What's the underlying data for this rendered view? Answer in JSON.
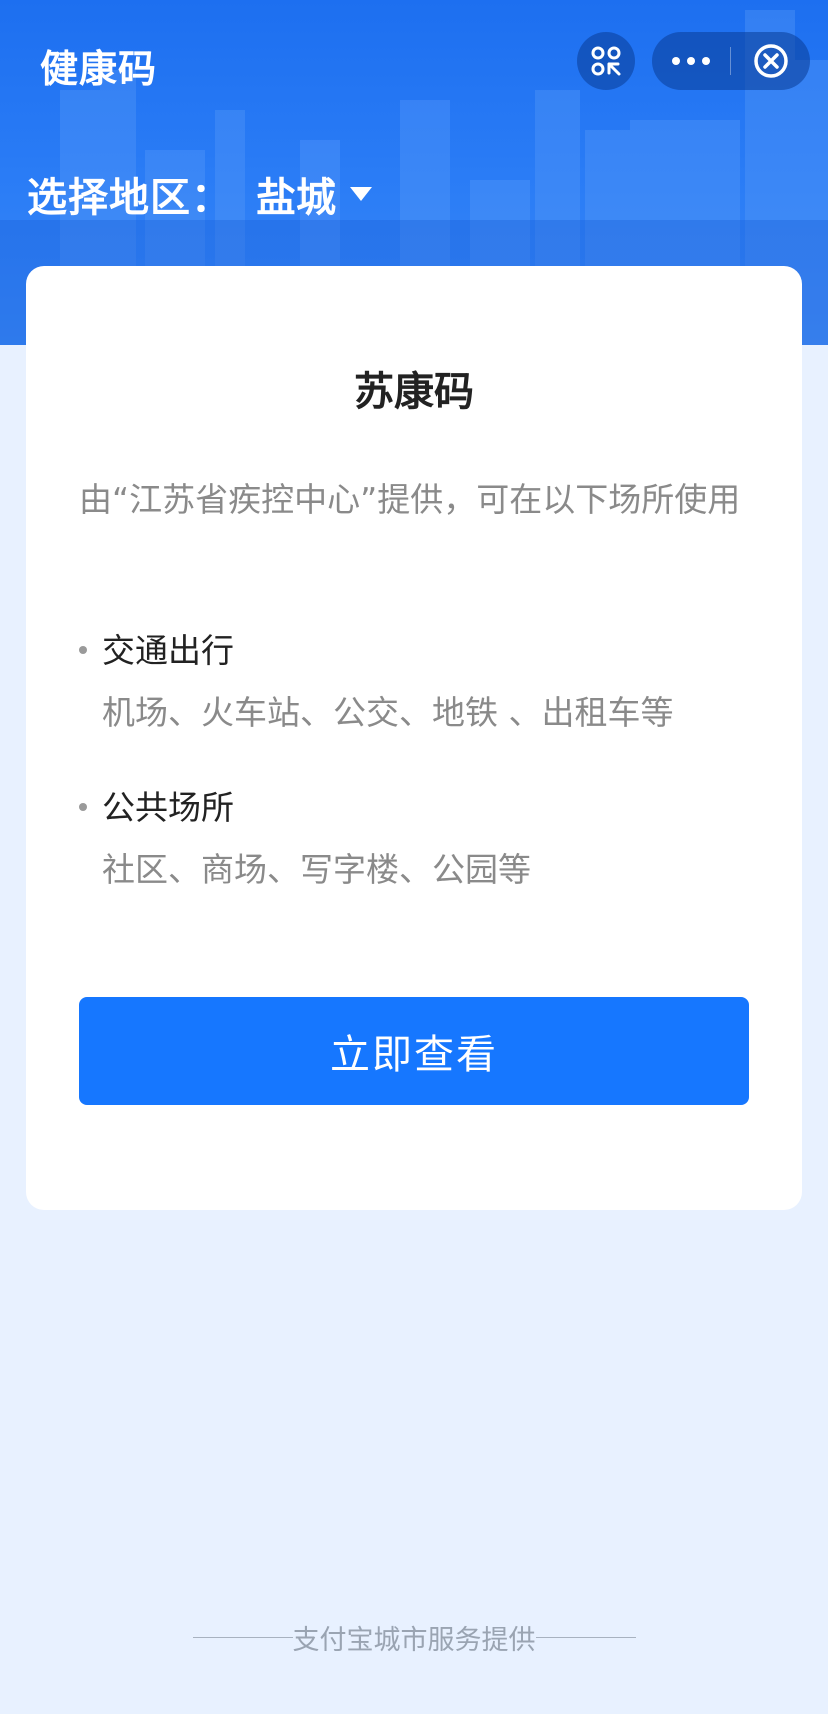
{
  "header": {
    "title": "健康码",
    "scan_icon": "mini-program-scan-icon",
    "more_icon": "more-dots-icon",
    "close_icon": "close-circle-icon"
  },
  "region": {
    "label": "选择地区：",
    "selected": "盐城"
  },
  "card": {
    "title": "苏康码",
    "description": "由“江苏省疾控中心”提供，可在以下场所使用",
    "sections": [
      {
        "heading": "交通出行",
        "detail": "机场、火车站、公交、地铁 、出租车等"
      },
      {
        "heading": "公共场所",
        "detail": "社区、商场、写字楼、公园等"
      }
    ],
    "button_label": "立即查看"
  },
  "footer": {
    "text": "支付宝城市服务提供"
  },
  "colors": {
    "primary": "#1677ff",
    "banner": "#2b7df6",
    "background": "#e8f1ff"
  }
}
